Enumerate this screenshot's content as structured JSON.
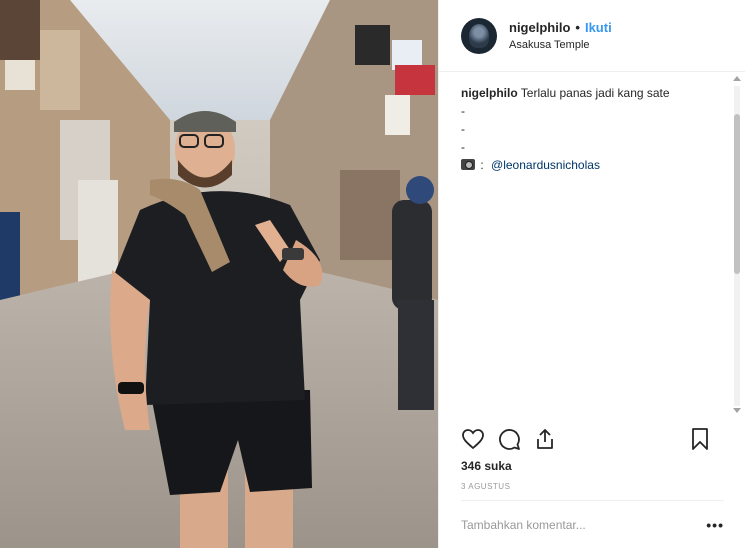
{
  "post": {
    "photo_alt": "",
    "user": {
      "username": "nigelphilo",
      "separator": "•",
      "follow_label": "Ikuti",
      "location": "Asakusa Temple"
    },
    "caption": {
      "username": "nigelphilo",
      "text": "Terlalu panas jadi kang sate",
      "lines": [
        "-",
        "-",
        "-"
      ],
      "credit_colon": ":",
      "credit_mention": "@leonardusnicholas"
    },
    "likes": "346 suka",
    "date": "3 AGUSTUS",
    "comment_placeholder": "Tambahkan komentar...",
    "more_label": "•••"
  },
  "icons": {
    "like": "heart-icon",
    "comment": "comment-icon",
    "share": "share-icon",
    "save": "bookmark-icon",
    "camera": "camera-icon"
  },
  "colors": {
    "link": "#3897f0",
    "mention": "#003569",
    "text": "#262626",
    "muted": "#999999",
    "border": "#efefef"
  }
}
